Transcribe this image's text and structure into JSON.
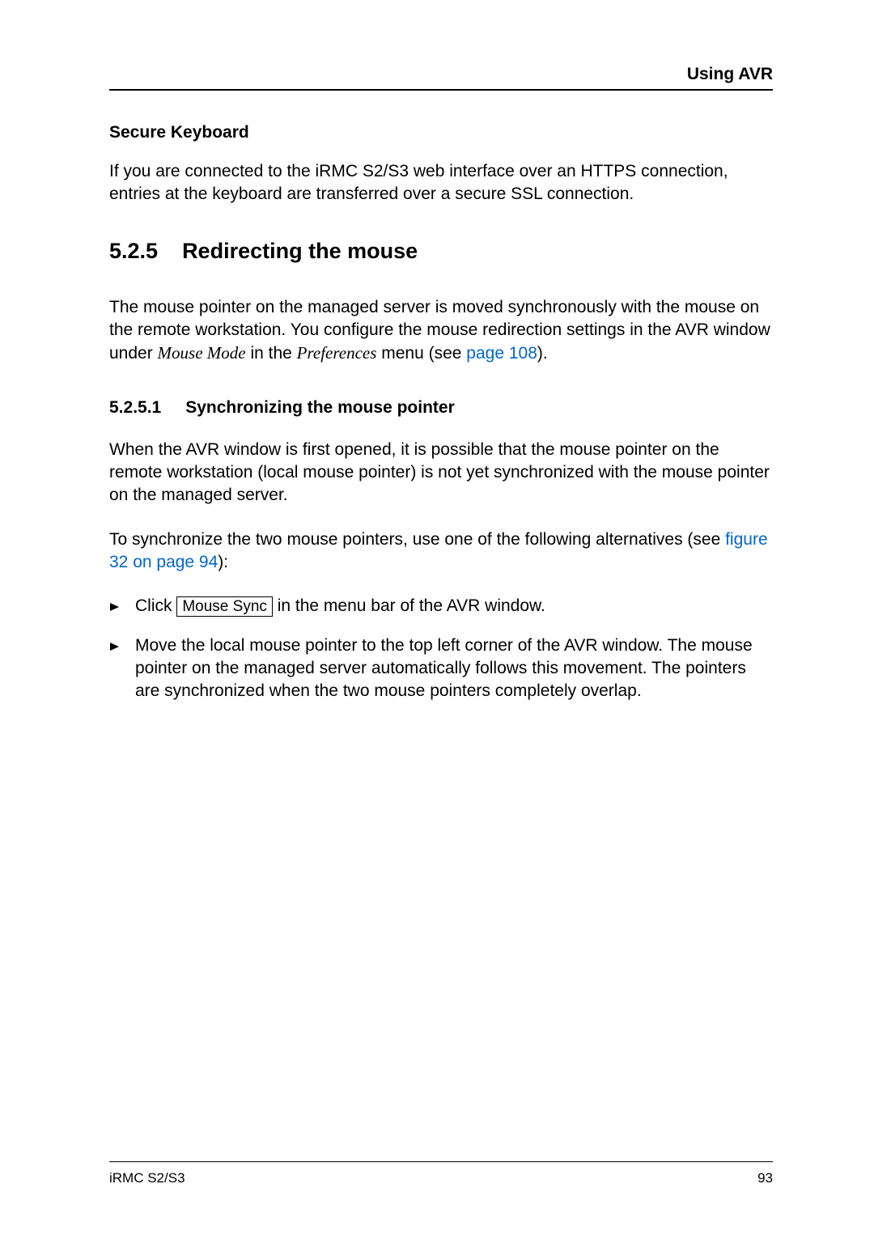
{
  "header": {
    "title": "Using AVR"
  },
  "secure_keyboard": {
    "heading": "Secure Keyboard",
    "body": "If you are connected to the iRMC S2/S3 web interface over an HTTPS connection, entries at the keyboard are transferred over a secure SSL connection."
  },
  "section": {
    "number": "5.2.5",
    "title": "Redirecting the mouse"
  },
  "intro": {
    "text_before": "The mouse pointer on the managed server is moved synchronously with the mouse on the remote workstation. You configure the mouse redirection settings in the AVR window under ",
    "italic1": "Mouse Mode",
    "mid1": " in the ",
    "italic2": "Preferences",
    "mid2": " menu (see ",
    "link": "page 108",
    "after": ")."
  },
  "subsection": {
    "number": "5.2.5.1",
    "title": "Synchronizing the mouse pointer"
  },
  "para1": "When the AVR window is first opened, it is possible that the mouse pointer on the remote workstation (local mouse pointer) is not yet synchronized with the mouse pointer on the managed server.",
  "para2": {
    "before": "To synchronize the two mouse pointers, use one of the following alternatives (see ",
    "link": "figure 32 on page 94",
    "after": "):"
  },
  "bullet1": {
    "before": "Click  ",
    "button": "Mouse Sync",
    "after": "  in the menu bar of the AVR window."
  },
  "bullet2": "Move the local mouse pointer to the top left corner of the AVR window. The mouse pointer on the managed server automatically follows this movement. The pointers are synchronized when the two mouse pointers completely overlap.",
  "footer": {
    "left": "iRMC S2/S3",
    "right": "93"
  }
}
